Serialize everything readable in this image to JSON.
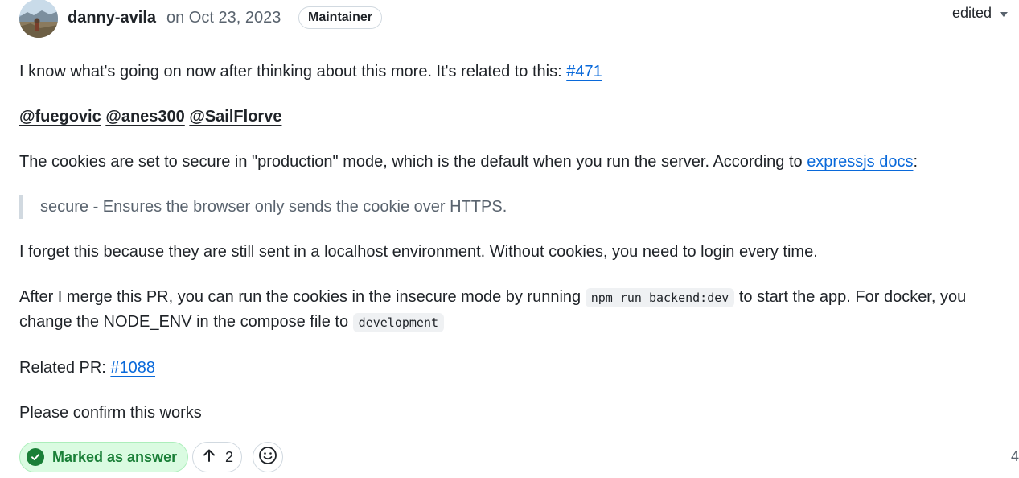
{
  "header": {
    "author": "danny-avila",
    "date": "on Oct 23, 2023",
    "role_badge": "Maintainer",
    "edited_label": "edited"
  },
  "body": {
    "p1_text": "I know what's going on now after thinking about this more. It's related to this: ",
    "p1_link": "#471",
    "mentions": [
      "@fuegovic",
      "@anes300",
      "@SailFlorve"
    ],
    "p3_text": "The cookies are set to secure in \"production\" mode, which is the default when you run the server. According to ",
    "p3_link": "expressjs docs",
    "p3_tail": ":",
    "quote": "secure - Ensures the browser only sends the cookie over HTTPS.",
    "p4_text": "I forget this because they are still sent in a localhost environment. Without cookies, you need to login every time.",
    "p5_text_a": "After I merge this PR, you can run the cookies in the insecure mode by running ",
    "p5_code_a": "npm run backend:dev",
    "p5_text_b": " to start the app. For docker, you change the NODE_ENV in the compose file to ",
    "p5_code_b": "development",
    "p6_text": "Related PR: ",
    "p6_link": "#1088",
    "p7_text": "Please confirm this works"
  },
  "footer": {
    "answer_label": "Marked as answer",
    "upvote_count": "2",
    "replies_count": "4"
  },
  "colors": {
    "link": "#0969da",
    "answer_green": "#1a7f37",
    "answer_bg": "#dafbe1",
    "muted": "#59636e"
  },
  "icons": {
    "avatar": "user-avatar",
    "caret": "chevron-down-icon",
    "check": "check-circle-icon",
    "upvote": "arrow-up-icon",
    "emoji": "smiley-icon"
  }
}
